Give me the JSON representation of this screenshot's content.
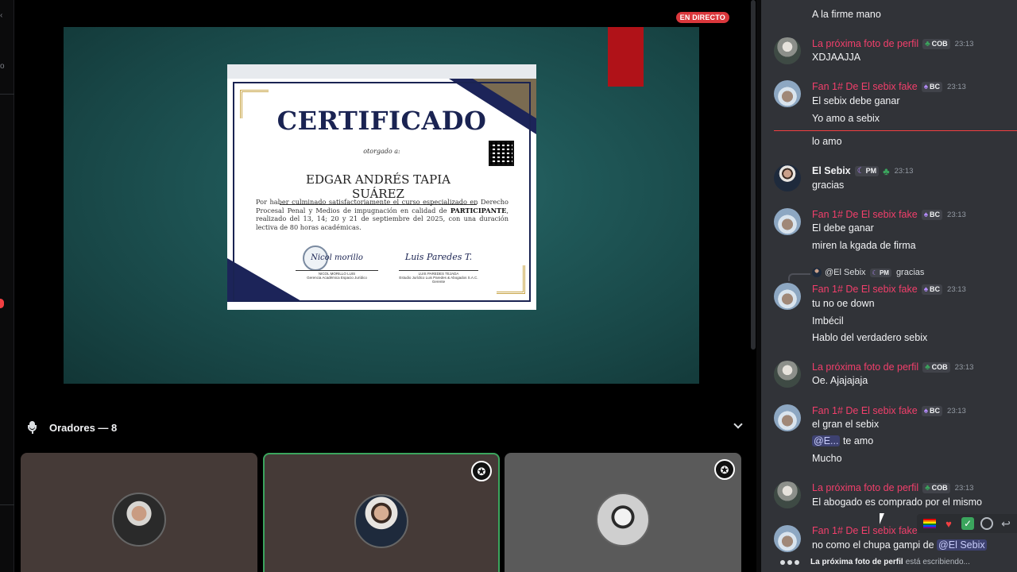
{
  "stage": {
    "live_badge": "EN DIRECTO",
    "certificate": {
      "title": "CERTIFICADO",
      "awarded_to": "otorgado a:",
      "recipient": "EDGAR ANDRÉS TAPIA SUÁREZ",
      "body_1": "Por haber culminado satisfactoriamente el curso especializado en Derecho Procesal Penal y Medios de impugnación en calidad de ",
      "body_bold": "PARTICIPANTE",
      "body_2": ", realizado del 13, 14; 20 y 21 de septiembre del 2025, con una duración lectiva de 80 horas académicas.",
      "signature_1": "Nicol morillo",
      "signer_1": "NICOL MORILLO LUIS",
      "signer_1_role": "Gerencia Académica Espacio Jurídico",
      "signature_2": "Luis Paredes T.",
      "signer_2": "LUIS PAREDES TEJADA",
      "signer_2_role": "Estudio Jurídico Luis Paredes & Abogados S.A.C. Gerente"
    },
    "speakers_title": "Oradores — 8"
  },
  "chat": {
    "messages": [
      {
        "line": "A la firme mano"
      },
      {
        "user": "La próxima foto de perfil",
        "tag": "COB",
        "time": "23:13",
        "lines": [
          "XDJAAJJA"
        ]
      },
      {
        "user": "Fan 1# De El sebix fake",
        "tag": "BC",
        "time": "23:13",
        "lines": [
          "El sebix debe ganar",
          "Yo amo a sebix"
        ]
      },
      {
        "line": "lo amo"
      },
      {
        "user": "El Sebix",
        "tag": "PM",
        "time": "23:13",
        "lines": [
          "gracias"
        ]
      },
      {
        "user": "Fan 1# De El sebix fake",
        "tag": "BC",
        "time": "23:13",
        "lines": [
          "El debe ganar",
          "miren la kgada de firma"
        ]
      },
      {
        "reply_user": "@El Sebix",
        "reply_tag": "PM",
        "reply_text": "gracias",
        "user": "Fan 1# De El sebix fake",
        "tag": "BC",
        "time": "23:13",
        "lines": [
          "tu no oe down",
          "Imbécil",
          "Hablo del verdadero sebix"
        ]
      },
      {
        "user": "La próxima foto de perfil",
        "tag": "COB",
        "time": "23:13",
        "lines": [
          "Oe. Ajajajaja"
        ]
      },
      {
        "user": "Fan 1# De El sebix fake",
        "tag": "BC",
        "time": "23:13",
        "lines": [
          "el gran el sebix",
          "te amo",
          "Mucho"
        ],
        "mention": "@E..."
      },
      {
        "user": "La próxima foto de perfil",
        "tag": "COB",
        "time": "23:13",
        "lines": [
          "El abogado es comprado por el mismo"
        ]
      },
      {
        "user": "Fan 1# De El sebix fake",
        "line": "no como el chupa gampi de ",
        "mention": "@El Sebix"
      }
    ],
    "typing_user": "La próxima foto de perfil",
    "typing_suffix": "está escribiendo..."
  }
}
